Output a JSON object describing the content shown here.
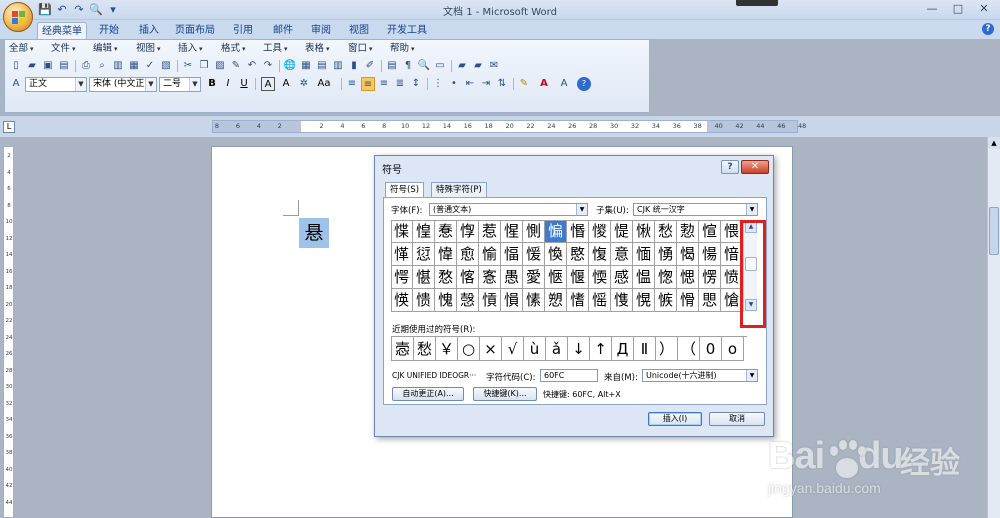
{
  "window": {
    "title": "文档 1 - Microsoft Word",
    "controls": [
      "—",
      "□",
      "✕"
    ]
  },
  "quick_access": [
    "💾",
    "↶",
    "↷",
    "🔍",
    "▾"
  ],
  "ribbon_tabs": [
    {
      "label": "经典菜单",
      "active": true
    },
    {
      "label": "开始"
    },
    {
      "label": "插入"
    },
    {
      "label": "页面布局"
    },
    {
      "label": "引用"
    },
    {
      "label": "邮件"
    },
    {
      "label": "审阅"
    },
    {
      "label": "视图"
    },
    {
      "label": "开发工具"
    }
  ],
  "menubar": [
    "全部",
    "文件",
    "编辑",
    "视图",
    "插入",
    "格式",
    "工具",
    "表格",
    "窗口",
    "帮助"
  ],
  "toolbar": {
    "style_combo": "正文",
    "font_combo": "宋体 (中文正文",
    "size_combo": "二号",
    "bold": "B",
    "italic": "I",
    "underline": "U",
    "font_frame": "A",
    "char_scale": "A",
    "change_case": "Aa"
  },
  "ruler": {
    "h_ticks": [
      "8",
      "6",
      "4",
      "2",
      "",
      "2",
      "4",
      "6",
      "8",
      "10",
      "12",
      "14",
      "16",
      "18",
      "20",
      "22",
      "24",
      "26",
      "28",
      "30",
      "32",
      "34",
      "36",
      "38",
      "40",
      "42",
      "44",
      "46",
      "48"
    ],
    "v_ticks": [
      "2",
      "4",
      "6",
      "8",
      "10",
      "12",
      "14",
      "16",
      "18",
      "20",
      "22",
      "24",
      "26",
      "28",
      "30",
      "32",
      "34",
      "36",
      "38",
      "40",
      "42",
      "44"
    ],
    "corner": "L"
  },
  "document": {
    "selected_char": "悬"
  },
  "dialog": {
    "title": "符号",
    "help": "?",
    "close": "✕",
    "tabs": [
      "符号(S)",
      "特殊字符(P)"
    ],
    "font_label": "字体(F):",
    "font_value": "(普通文本)",
    "subset_label": "子集(U):",
    "subset_value": "CJK 统一汉字",
    "grid": [
      [
        "惵",
        "惶",
        "惷",
        "惸",
        "惹",
        "惺",
        "惻",
        "惼",
        "惽",
        "惾",
        "惿",
        "愀",
        "愁",
        "愂",
        "愃",
        "愄"
      ],
      [
        "愅",
        "愆",
        "愇",
        "愈",
        "愉",
        "愊",
        "愋",
        "愌",
        "愍",
        "愎",
        "意",
        "愐",
        "愑",
        "愒",
        "愓",
        "愔"
      ],
      [
        "愕",
        "愖",
        "愗",
        "愘",
        "愙",
        "愚",
        "愛",
        "愜",
        "愝",
        "愞",
        "感",
        "愠",
        "愡",
        "愢",
        "愣",
        "愤"
      ],
      [
        "愥",
        "愦",
        "愧",
        "愨",
        "愩",
        "愪",
        "愫",
        "愬",
        "愭",
        "愮",
        "愯",
        "愰",
        "愱",
        "愲",
        "愳",
        "愴"
      ]
    ],
    "selected_cell": "惼",
    "recent_label": "近期使用过的符号(R):",
    "recent": [
      "悫",
      "愁",
      "￥",
      "○",
      "×",
      "√",
      "ù",
      "ǎ",
      "↓",
      "↑",
      "Д",
      "Ⅱ",
      "）",
      "（",
      "0",
      "o"
    ],
    "unicode_name": "CJK UNIFIED IDEOGR···",
    "code_label": "字符代码(C):",
    "code_value": "60FC",
    "from_label": "来自(M):",
    "from_value": "Unicode(十六进制)",
    "autocorrect_button": "自动更正(A)...",
    "shortcut_button": "快捷键(K)...",
    "shortcut_info": "快捷键: 60FC, Alt+X",
    "insert_button": "插入(I)",
    "cancel_button": "取消"
  },
  "watermark": {
    "brand": "Bai",
    "brand_suffix": "du",
    "cn": "经验",
    "url": "jingyan.baidu.com"
  },
  "colors": {
    "highlight_red": "#e01f1f",
    "selection_blue": "#3b7bd4"
  }
}
